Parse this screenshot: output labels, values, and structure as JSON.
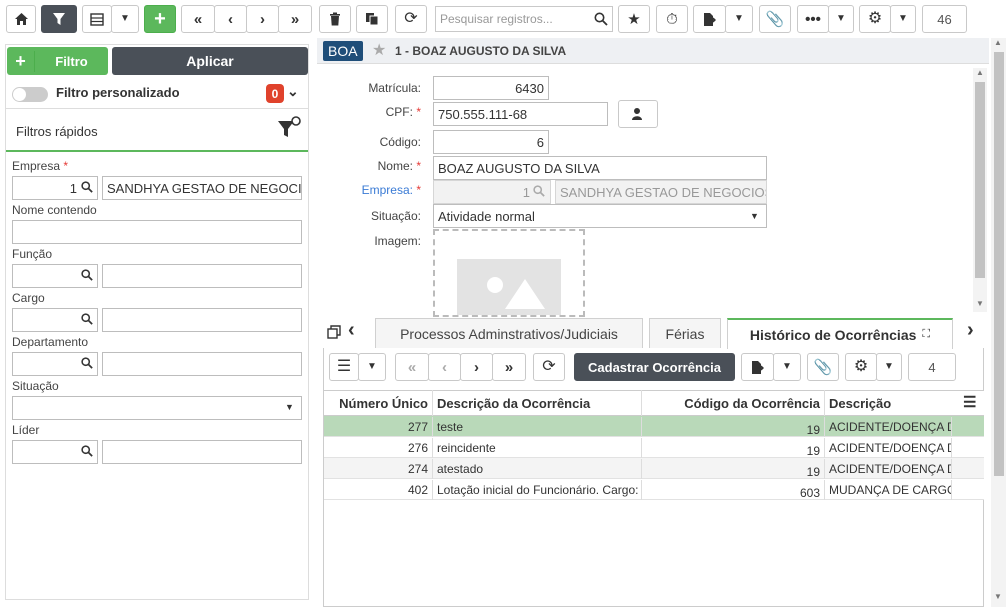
{
  "toolbar": {
    "search_placeholder": "Pesquisar registros...",
    "count": "46"
  },
  "left": {
    "filter_button": "Filtro",
    "apply_button": "Aplicar",
    "custom_filter_label": "Filtro personalizado",
    "custom_filter_count": "0",
    "quick_filters_title": "Filtros rápidos",
    "empresa_label": "Empresa",
    "empresa_code": "1",
    "empresa_name": "SANDHYA GESTAO DE NEGOCIOS",
    "nome_contendo_label": "Nome contendo",
    "funcao_label": "Função",
    "cargo_label": "Cargo",
    "departamento_label": "Departamento",
    "situacao_label": "Situação",
    "lider_label": "Líder"
  },
  "record": {
    "badge": "BOA",
    "title": "1 - BOAZ AUGUSTO DA SILVA",
    "matricula_label": "Matrícula:",
    "matricula": "6430",
    "cpf_label": "CPF:",
    "cpf": "750.555.111-68",
    "codigo_label": "Código:",
    "codigo": "6",
    "nome_label": "Nome:",
    "nome": "BOAZ AUGUSTO DA SILVA",
    "empresa_label": "Empresa:",
    "empresa_code": "1",
    "empresa_name": "SANDHYA GESTAO DE NEGOCIOS",
    "situacao_label": "Situação:",
    "situacao": "Atividade normal",
    "imagem_label": "Imagem:"
  },
  "tabs": [
    "Processos Adminstrativos/Judiciais",
    "Férias",
    "Histórico de Ocorrências"
  ],
  "grid": {
    "register_button": "Cadastrar Ocorrência",
    "count": "4",
    "columns": [
      "Número Único",
      "Descrição da Ocorrência",
      "Código da Ocorrência",
      "Descrição"
    ],
    "rows": [
      {
        "numero": "277",
        "descricao": "teste",
        "codigo": "19",
        "desc2": "ACIDENTE/DOENÇA DO TRABALHO"
      },
      {
        "numero": "276",
        "descricao": "reincidente",
        "codigo": "19",
        "desc2": "ACIDENTE/DOENÇA DO TRABALHO"
      },
      {
        "numero": "274",
        "descricao": "atestado",
        "codigo": "19",
        "desc2": "ACIDENTE/DOENÇA DO TRABALHO"
      },
      {
        "numero": "402",
        "descricao": "Lotação inicial do Funcionário. Cargo:",
        "codigo": "603",
        "desc2": "MUDANÇA DE CARGO"
      }
    ]
  },
  "colors": {
    "accent_green": "#5cb85c",
    "dark_button": "#4a5058",
    "selected_row": "#b9d9b9",
    "badge_red": "#e0422c",
    "badge_blue": "#1f4e79"
  }
}
